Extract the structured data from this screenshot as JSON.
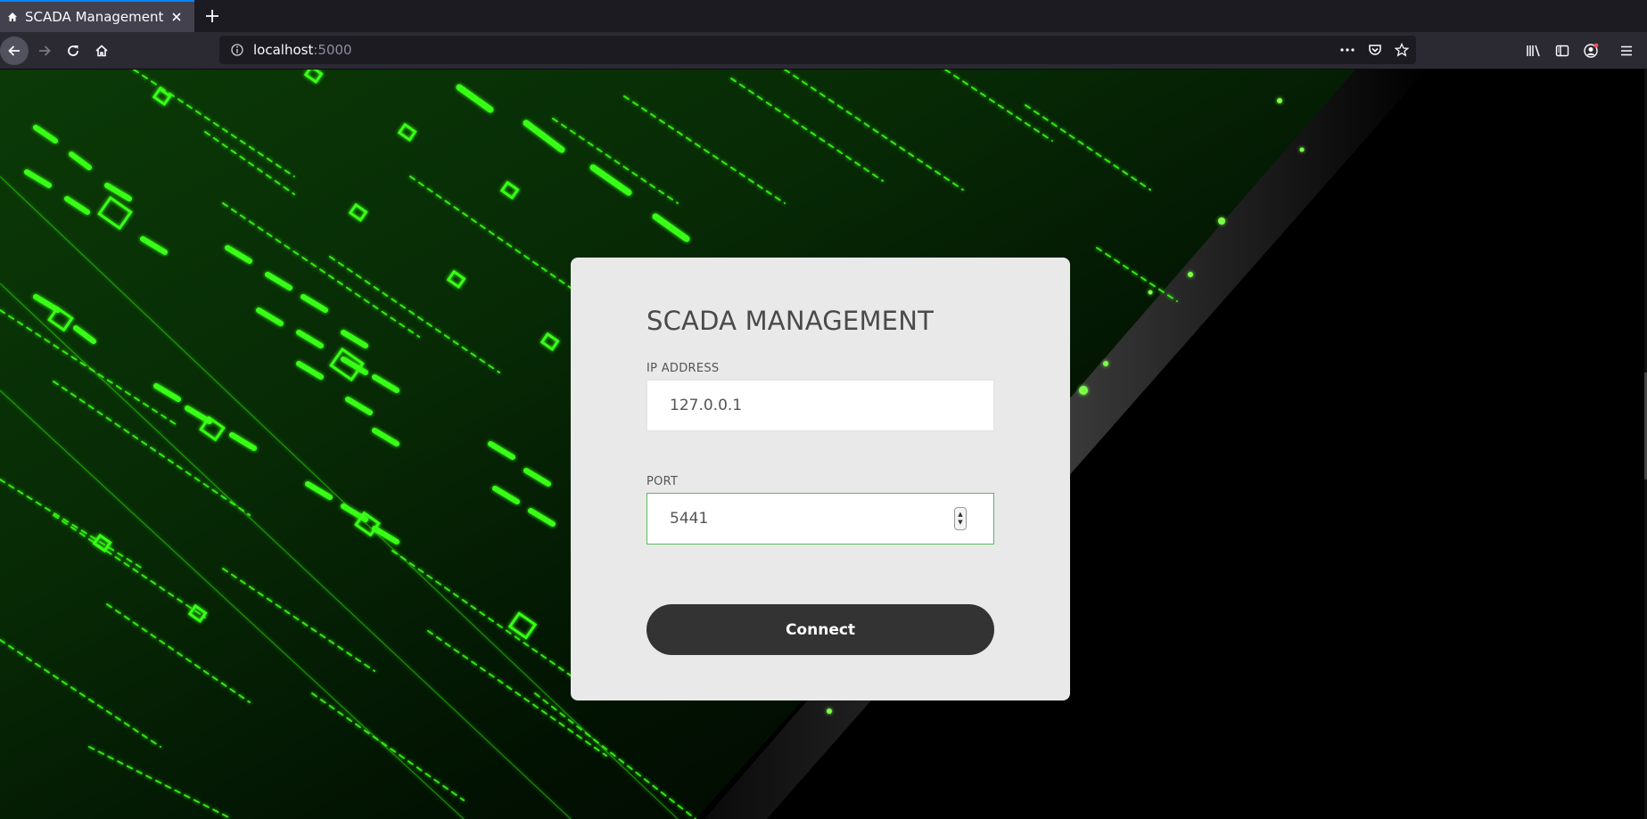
{
  "browser": {
    "tab": {
      "title": "SCADA Management",
      "favicon": "home-icon"
    },
    "url": {
      "host": "localhost",
      "port": ":5000"
    },
    "nav_icons": [
      "back-arrow-icon",
      "forward-arrow-icon",
      "reload-icon",
      "home-icon"
    ],
    "url_icons": [
      "info-icon",
      "more-dots-icon",
      "pocket-icon",
      "bookmark-star-icon"
    ],
    "toolbar_icons": [
      "library-icon",
      "sidebar-icon",
      "account-icon",
      "menu-icon"
    ]
  },
  "login": {
    "title": "SCADA MANAGEMENT",
    "ip_label": "IP ADDRESS",
    "ip_value": "127.0.0.1",
    "port_label": "PORT",
    "port_value": "5441",
    "connect_label": "Connect"
  },
  "colors": {
    "accent_green": "#39ff14",
    "card_bg": "#e9e9e9",
    "button_bg": "#333333",
    "focus_border": "#5cb85c"
  }
}
